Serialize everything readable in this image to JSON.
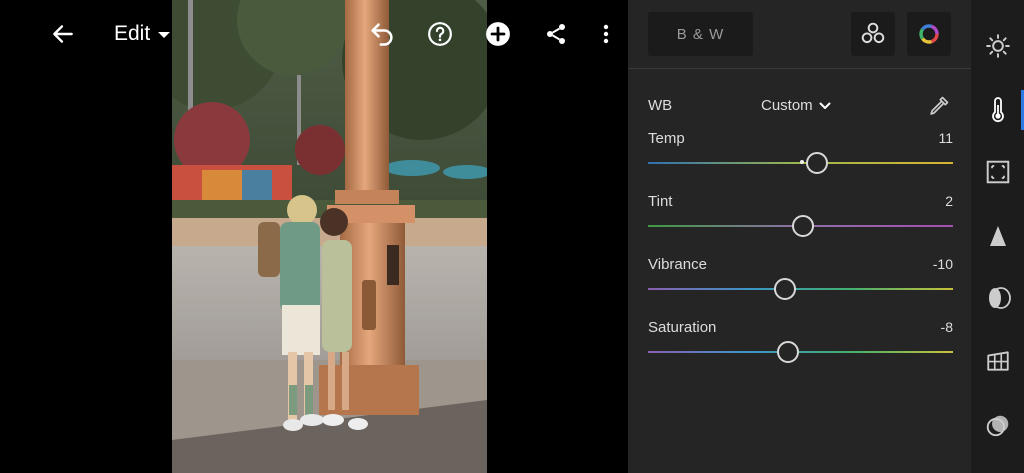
{
  "header": {
    "mode_label": "Edit",
    "icons": [
      "back-arrow-icon",
      "undo-icon",
      "help-icon",
      "add-icon",
      "share-icon",
      "more-vert-icon"
    ]
  },
  "photo": {
    "description_icon": "photo-preview"
  },
  "panel": {
    "bw_label": "B & W",
    "wb": {
      "label": "WB",
      "value": "Custom"
    },
    "sliders": [
      {
        "label": "Temp",
        "value": "11",
        "fraction": 0.553,
        "gradient": [
          "#2d6fb0",
          "#9db84b",
          "#d9b332"
        ]
      },
      {
        "label": "Tint",
        "value": "2",
        "fraction": 0.507,
        "gradient": [
          "#3f9a44",
          "#8f6fa8",
          "#a54fb0"
        ]
      },
      {
        "label": "Vibrance",
        "value": "-10",
        "fraction": 0.45,
        "gradient": [
          "#8a5fb0",
          "#3c95c8",
          "#43b06e",
          "#c9c23a"
        ]
      },
      {
        "label": "Saturation",
        "value": "-8",
        "fraction": 0.46,
        "gradient": [
          "#8a5fb0",
          "#3c95c8",
          "#43b06e",
          "#c9c23a"
        ]
      }
    ]
  },
  "rail": {
    "items": [
      "light-icon",
      "color-temp-icon",
      "effects-icon",
      "detail-icon",
      "optics-icon",
      "geometry-icon",
      "presets-icon"
    ],
    "active_index": 1
  },
  "colors": {
    "panel_bg": "#252525",
    "rail_bg": "#1c1c1c",
    "accent": "#2d7be6"
  }
}
